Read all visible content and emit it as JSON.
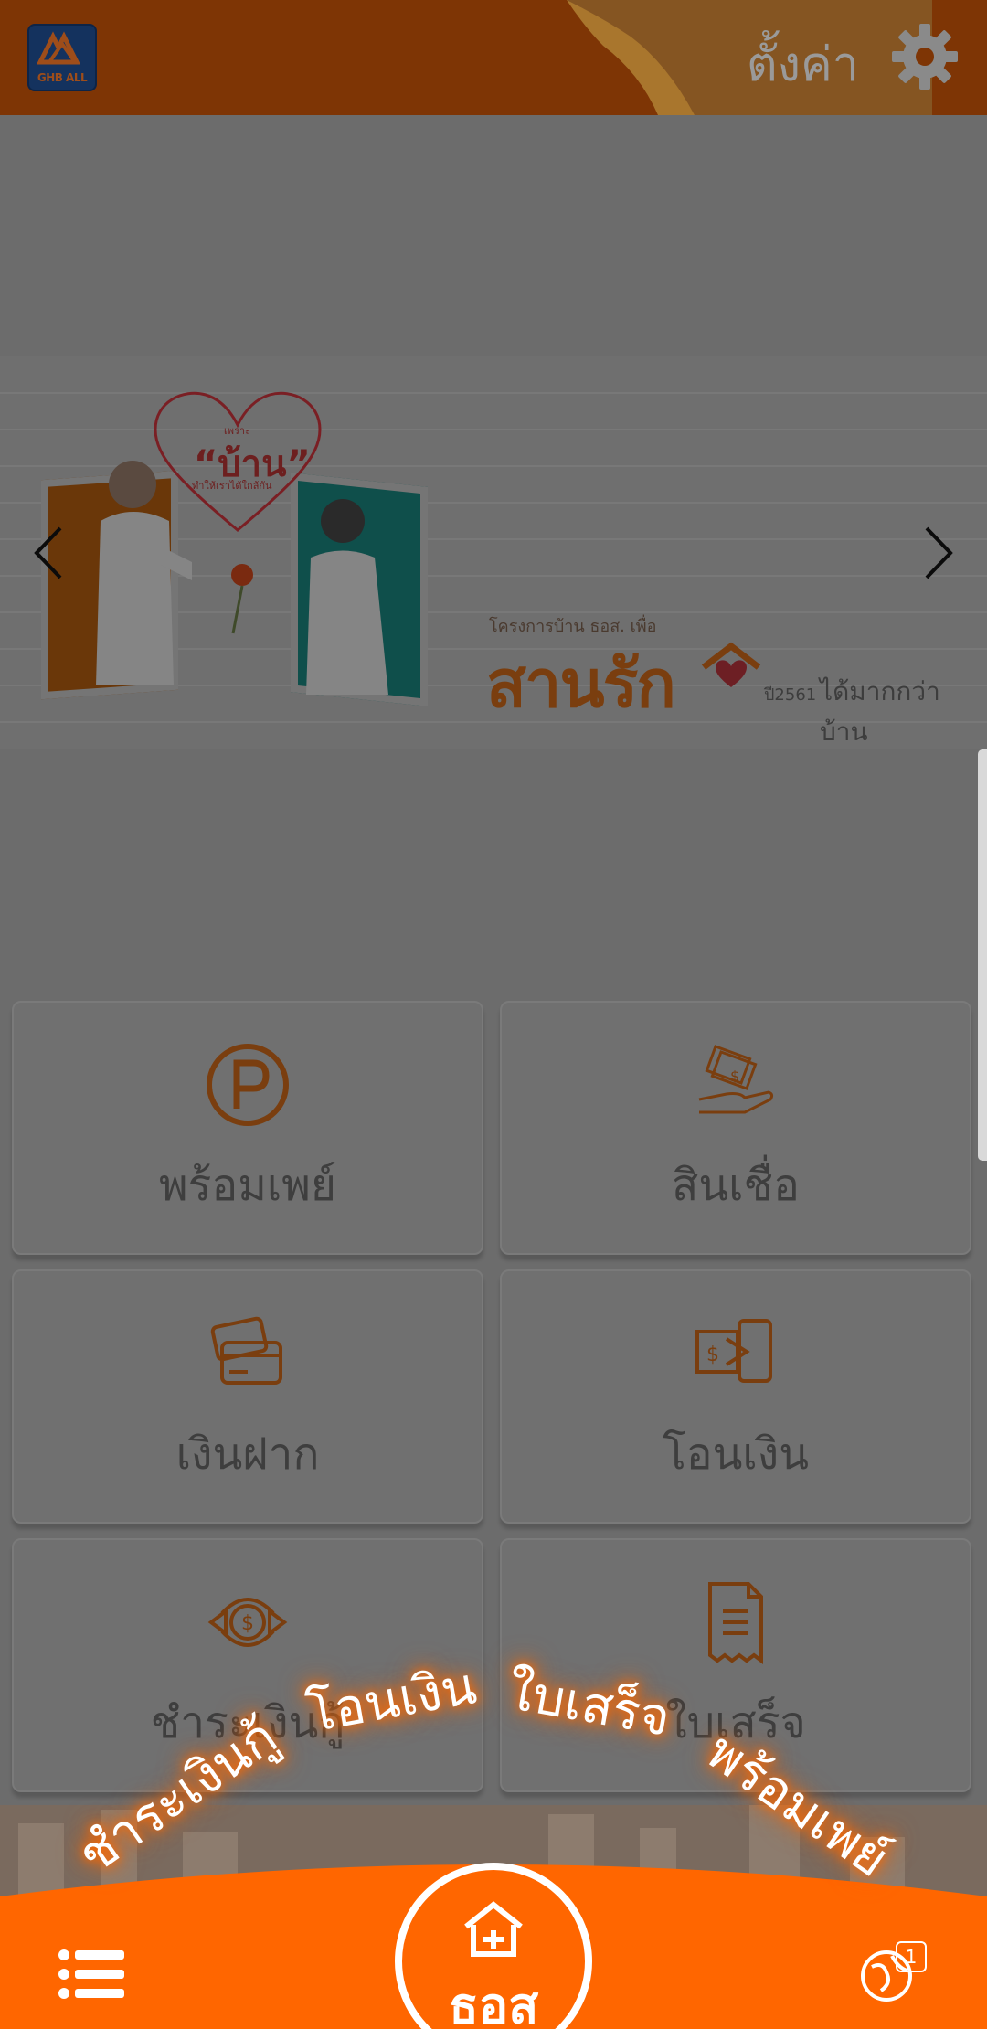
{
  "header": {
    "logo_text": "GHB ALL",
    "settings_label": "ตั้งค่า"
  },
  "banner": {
    "heart_small": "เพราะ",
    "heart_big": "“บ้าน”",
    "heart_sub": "ทำให้เราได้ใกล้กัน",
    "project_line": "โครงการบ้าน ธอส. เพื่อ",
    "brand": "สานรัก",
    "year": "ปี2561",
    "tagline": "ได้มากกว่าบ้าน"
  },
  "tiles": [
    {
      "label": "พร้อมเพย์",
      "icon": "promptpay-icon"
    },
    {
      "label": "สินเชื่อ",
      "icon": "loan-icon"
    },
    {
      "label": "เงินฝาก",
      "icon": "deposit-icon"
    },
    {
      "label": "โอนเงิน",
      "icon": "transfer-icon"
    },
    {
      "label": "ชำระเงินกู้",
      "icon": "loan-payment-icon"
    },
    {
      "label": "ใบเสร็จ",
      "icon": "receipt-icon"
    }
  ],
  "quick_actions": [
    "ชำระเงินกู้",
    "โอนเงิน",
    "ใบเสร็จ",
    "พร้อมเพย์"
  ],
  "bottom_bar": {
    "center_label": "ธอส",
    "notification_count": "1"
  },
  "colors": {
    "accent": "#ff6600",
    "header_dim": "#7e3505",
    "overlay": "#6c6c6c"
  }
}
